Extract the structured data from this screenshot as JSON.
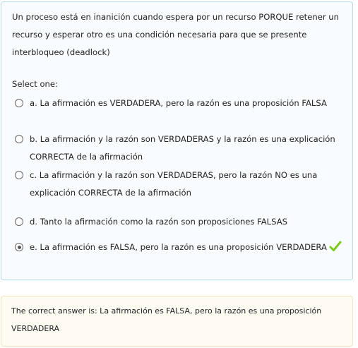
{
  "question": {
    "text": "Un proceso está en inanición cuando espera por un recurso PORQUE retener un recurso y esperar otro es una condición necesaria para que se presente interbloqueo (deadlock)",
    "prompt": "Select one:"
  },
  "options": [
    {
      "label": "a. La afirmación es VERDADERA, pero la razón es una proposición FALSA",
      "selected": false
    },
    {
      "label": "b. La afirmación y la razón son VERDADERAS y la razón es una explicación CORRECTA de la afirmación",
      "selected": false
    },
    {
      "label": "c. La afirmación y la razón son VERDADERAS, pero la razón NO es una explicación CORRECTA de la afirmación",
      "selected": false
    },
    {
      "label": "d. Tanto la afirmación como la razón son proposiciones FALSAS",
      "selected": false
    },
    {
      "label": "e. La afirmación es FALSA, pero la razón es una proposición VERDADERA",
      "selected": true,
      "icon": "check-icon"
    }
  ],
  "feedback": {
    "text": "The correct answer is: La afirmación es FALSA, pero la razón es una proposición VERDADERA"
  },
  "colors": {
    "check": "#7cc81e",
    "question_border": "#b9dfee",
    "feedback_border": "#f6e2bd"
  }
}
